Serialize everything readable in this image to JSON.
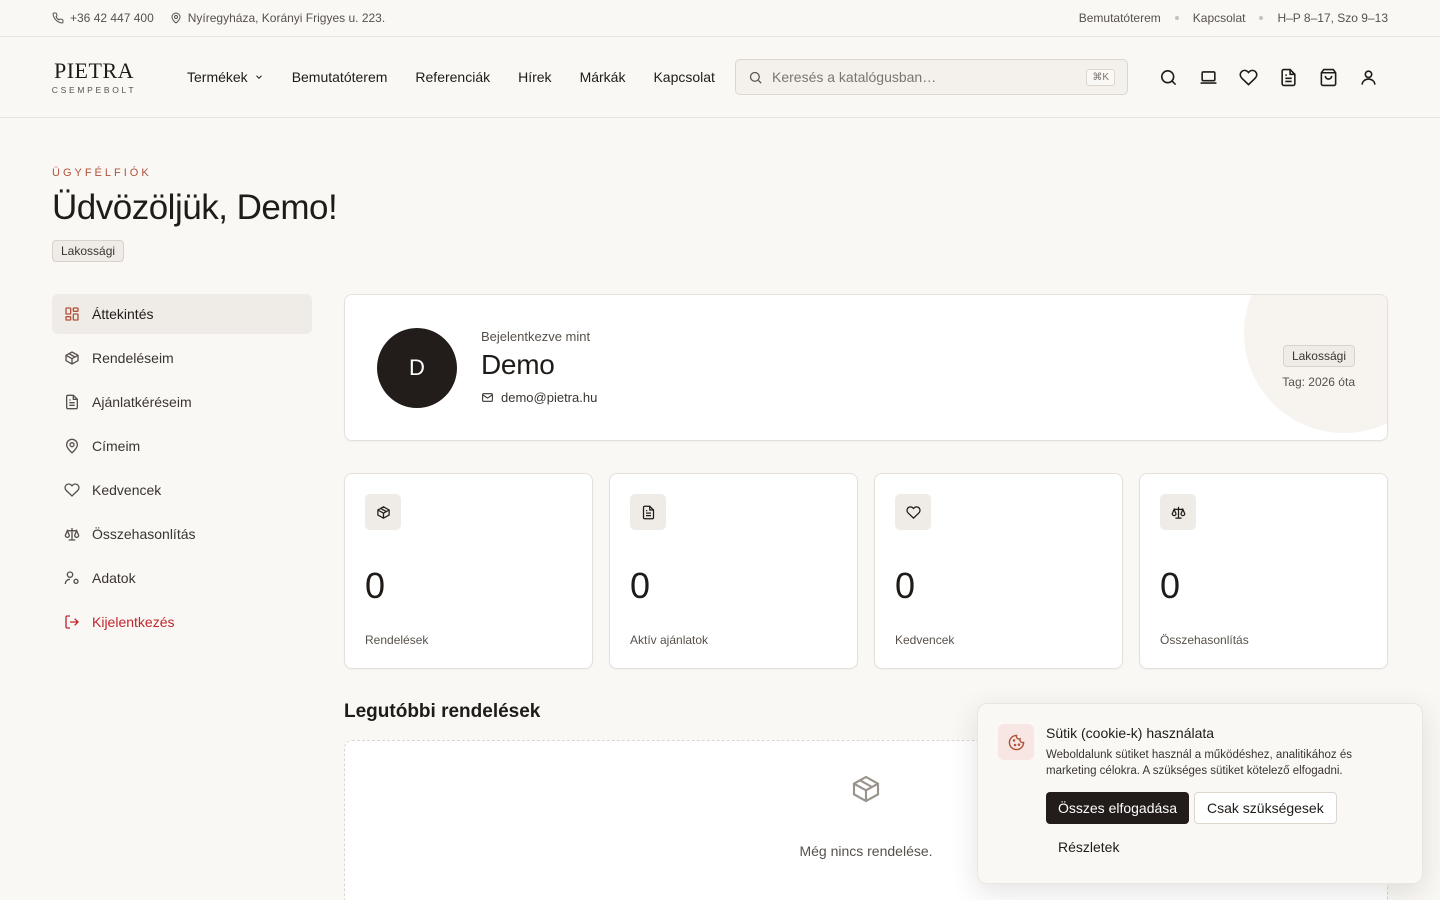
{
  "topbar": {
    "phone": "+36 42 447 400",
    "address": "Nyíregyháza, Korányi Frigyes u. 223.",
    "links": [
      "Bemutatóterem",
      "Kapcsolat"
    ],
    "hours": "H–P 8–17, Szo 9–13"
  },
  "header": {
    "logo": {
      "brand": "PIETRA",
      "sub": "CSEMPEBOLT"
    },
    "nav": [
      "Termékek",
      "Bemutatóterem",
      "Referenciák",
      "Hírek",
      "Márkák",
      "Kapcsolat"
    ],
    "search": {
      "placeholder": "Keresés a katalógusban…",
      "shortcut": "⌘K"
    },
    "icons": [
      "search-icon",
      "laptop-icon",
      "heart-icon",
      "document-icon",
      "shopping-bag-icon",
      "user-icon"
    ]
  },
  "page": {
    "eyebrow": "ÜGYFÉLFIÓK",
    "title": "Üdvözöljük, Demo!",
    "badge": "Lakossági"
  },
  "sidebar": {
    "items": [
      {
        "label": "Áttekintés",
        "icon": "grid-icon",
        "active": true
      },
      {
        "label": "Rendeléseim",
        "icon": "box-icon"
      },
      {
        "label": "Ajánlatkéréseim",
        "icon": "document-icon"
      },
      {
        "label": "Címeim",
        "icon": "map-pin-icon"
      },
      {
        "label": "Kedvencek",
        "icon": "heart-icon"
      },
      {
        "label": "Összehasonlítás",
        "icon": "scale-icon"
      },
      {
        "label": "Adatok",
        "icon": "user-cog-icon"
      },
      {
        "label": "Kijelentkezés",
        "icon": "logout-icon"
      }
    ]
  },
  "profile": {
    "initial": "D",
    "signed_in_as": "Bejelentkezve mint",
    "name": "Demo",
    "email": "demo@pietra.hu",
    "badge": "Lakossági",
    "member_since": "Tag: 2026 óta"
  },
  "stats": [
    {
      "value": "0",
      "label": "Rendelések",
      "icon": "box-icon"
    },
    {
      "value": "0",
      "label": "Aktív ajánlatok",
      "icon": "document-icon"
    },
    {
      "value": "0",
      "label": "Kedvencek",
      "icon": "heart-icon"
    },
    {
      "value": "0",
      "label": "Összehasonlítás",
      "icon": "scale-icon"
    }
  ],
  "recent_orders": {
    "title": "Legutóbbi rendelések",
    "empty": "Még nincs rendelése."
  },
  "cookie": {
    "title": "Sütik (cookie-k) használata",
    "text": "Weboldalunk sütiket használ a működéshez, analitikához és marketing célokra. A szükséges sütiket kötelező elfogadni.",
    "accept_all": "Összes elfogadása",
    "necessary_only": "Csak szükségesek",
    "details": "Részletek"
  },
  "colors": {
    "accent_eyebrow": "#b0523a",
    "logout": "#c0262d",
    "avatar_bg": "#221d1a",
    "page_bg": "#faf8f5"
  }
}
